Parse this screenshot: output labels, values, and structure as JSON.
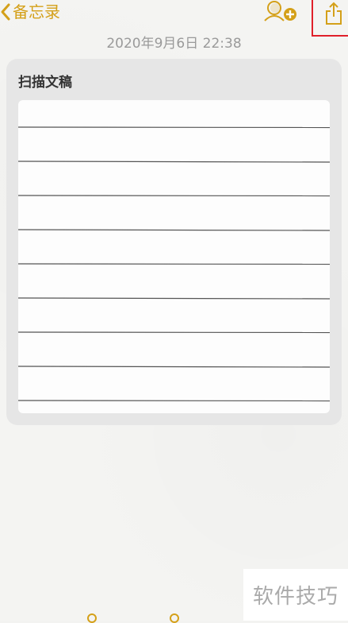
{
  "nav": {
    "back_label": "备忘录"
  },
  "note": {
    "date": "2020年9月6日 22:38",
    "scan_title": "扫描文稿",
    "ruled_line_count": 9
  },
  "watermark": {
    "text": "软件技巧"
  },
  "icons": {
    "back": "chevron-left-icon",
    "collaborate": "add-person-icon",
    "share": "share-icon"
  },
  "colors": {
    "accent": "#d4a019",
    "highlight_frame": "#e0202a",
    "date_text": "#9a9a9a"
  }
}
